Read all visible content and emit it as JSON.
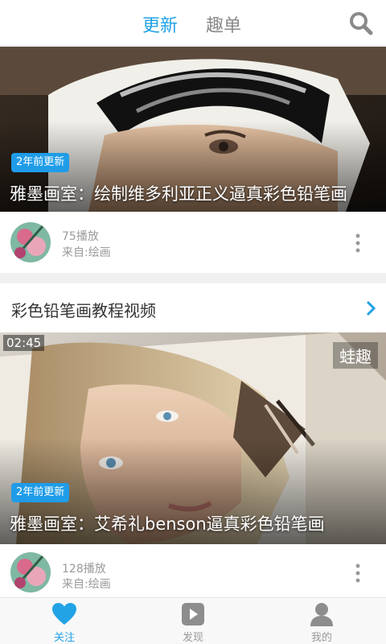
{
  "header": {
    "tab_active": "更新",
    "tab_inactive": "趣单"
  },
  "card1": {
    "badge": "2年前更新",
    "title": "雅墨画室：绘制维多利亚正义逼真彩色铅笔画",
    "plays": "75播放",
    "source": "来自:绘画"
  },
  "section": {
    "title": "彩色铅笔画教程视频"
  },
  "card2": {
    "duration": "02:45",
    "watermark": "蛙趣",
    "badge": "2年前更新",
    "title": "雅墨画室：艾希礼benson逼真彩色铅笔画",
    "plays": "128播放",
    "source": "来自:绘画"
  },
  "bottom_nav": {
    "follow": "关注",
    "discover": "发现",
    "mine": "我的"
  },
  "colors": {
    "accent": "#22a3e6",
    "badge": "#1f9ce8"
  }
}
